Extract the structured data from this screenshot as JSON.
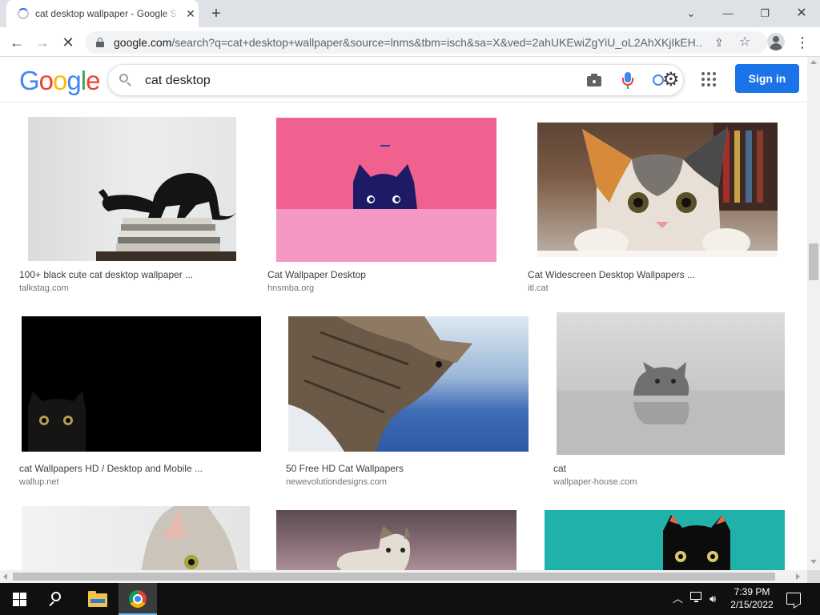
{
  "browser": {
    "tab_title": "cat desktop wallpaper - Google Search",
    "url_host": "google.com",
    "url_path": "/search?q=cat+desktop+wallpaper&source=lnms&tbm=isch&sa=X&ved=2ahUKEwiZgYiU_oL2AhXKjIkEH..."
  },
  "google": {
    "logo_letters": [
      "G",
      "o",
      "o",
      "g",
      "l",
      "e"
    ],
    "logo_colors": [
      "#4285f4",
      "#ea4335",
      "#fbbc05",
      "#4285f4",
      "#34a853",
      "#ea4335"
    ],
    "search_value": "cat desktop",
    "signin_label": "Sign in",
    "accent": "#1a73e8"
  },
  "icons": {
    "tab_close": "close-icon",
    "new_tab": "plus-icon",
    "back": "arrow-left-icon",
    "forward": "arrow-right-icon",
    "stop": "close-icon",
    "share": "share-icon",
    "bookmark": "star-icon",
    "search": "search-icon",
    "camera": "camera-icon",
    "mic": "microphone-icon",
    "lens": "lens-settings-icon",
    "apps": "apps-grid-icon"
  },
  "results": [
    {
      "title": "100+ black cute cat desktop wallpaper ...",
      "source": "talkstag.com"
    },
    {
      "title": "Cat Wallpaper Desktop",
      "source": "hnsmba.org"
    },
    {
      "title": "Cat Widescreen Desktop Wallpapers ...",
      "source": "itl.cat"
    },
    {
      "title": "cat Wallpapers HD / Desktop and Mobile ...",
      "source": "wallup.net"
    },
    {
      "title": "50 Free HD Cat Wallpapers",
      "source": "newevolutiondesigns.com"
    },
    {
      "title": "cat",
      "source": "wallpaper-house.com"
    },
    {
      "title": "",
      "source": ""
    },
    {
      "title": "",
      "source": ""
    },
    {
      "title": "",
      "source": ""
    }
  ],
  "taskbar": {
    "time": "7:39 PM",
    "date": "2/15/2022"
  }
}
